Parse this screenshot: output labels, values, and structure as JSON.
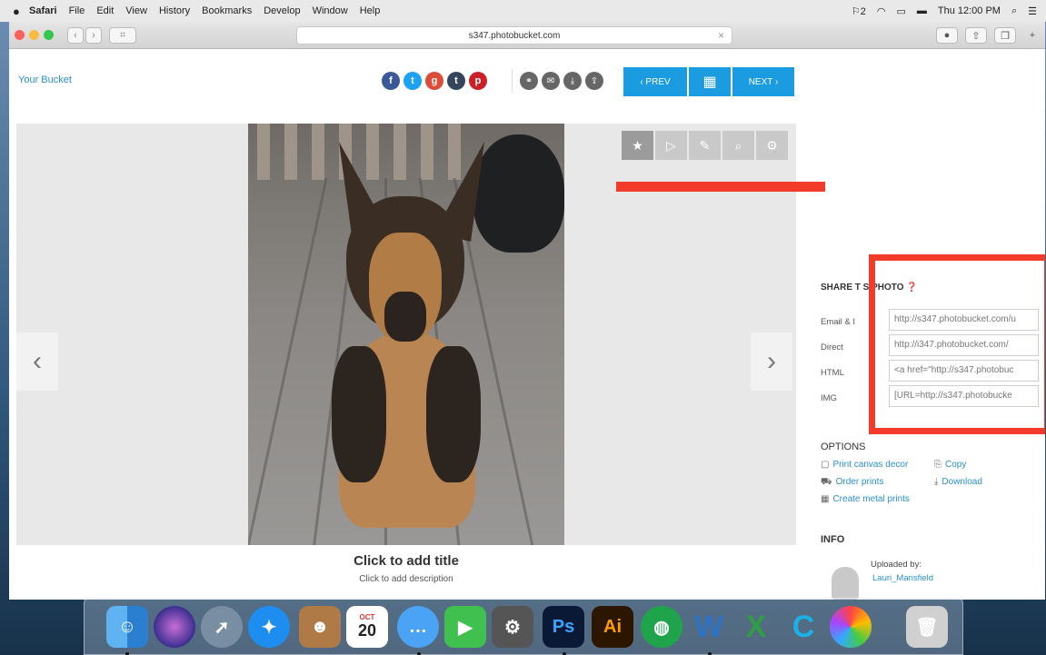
{
  "menubar": {
    "apple": "",
    "items": [
      "Safari",
      "File",
      "Edit",
      "View",
      "History",
      "Bookmarks",
      "Develop",
      "Window",
      "Help"
    ],
    "status": {
      "input": "2",
      "clock": "Thu 12:00 PM"
    }
  },
  "browser": {
    "url": "s347.photobucket.com",
    "tab_symbol": "⌗"
  },
  "page": {
    "your_bucket": "Your Bucket",
    "prev_label": "‹ PREV",
    "next_label": "NEXT ›",
    "photo_title": "Click to add title",
    "photo_desc": "Click to add description",
    "share": {
      "heading": "SHARE T  S PHOTO",
      "rows": [
        {
          "label": "Email & I",
          "value": "http://s347.photobucket.com/u"
        },
        {
          "label": "Direct",
          "value": "http://i347.photobucket.com/"
        },
        {
          "label": "HTML",
          "value": "<a href=\"http://s347.photobuc"
        },
        {
          "label": "IMG",
          "value": "[URL=http://s347.photobucke"
        }
      ]
    },
    "options": {
      "heading": "OPTIONS",
      "items": [
        {
          "label": "Print canvas decor",
          "icon": "canvas-icon"
        },
        {
          "label": "Copy",
          "icon": "copy-icon"
        },
        {
          "label": "Order prints",
          "icon": "cart-icon"
        },
        {
          "label": "Download",
          "icon": "download-icon"
        },
        {
          "label": "Create metal prints",
          "icon": "metal-icon"
        }
      ]
    },
    "info": {
      "heading": "INFO",
      "uploaded_by": "Uploaded by:",
      "uploader": "Lauri_Mansfield"
    }
  },
  "dock": {
    "calendar_month": "OCT",
    "calendar_day": "20",
    "ps": "Ps",
    "ai": "Ai",
    "word": "W",
    "excel": "X"
  },
  "colors": {
    "accent": "#1b9be0",
    "highlight": "#f23b2b",
    "link": "#2a8fd0"
  }
}
